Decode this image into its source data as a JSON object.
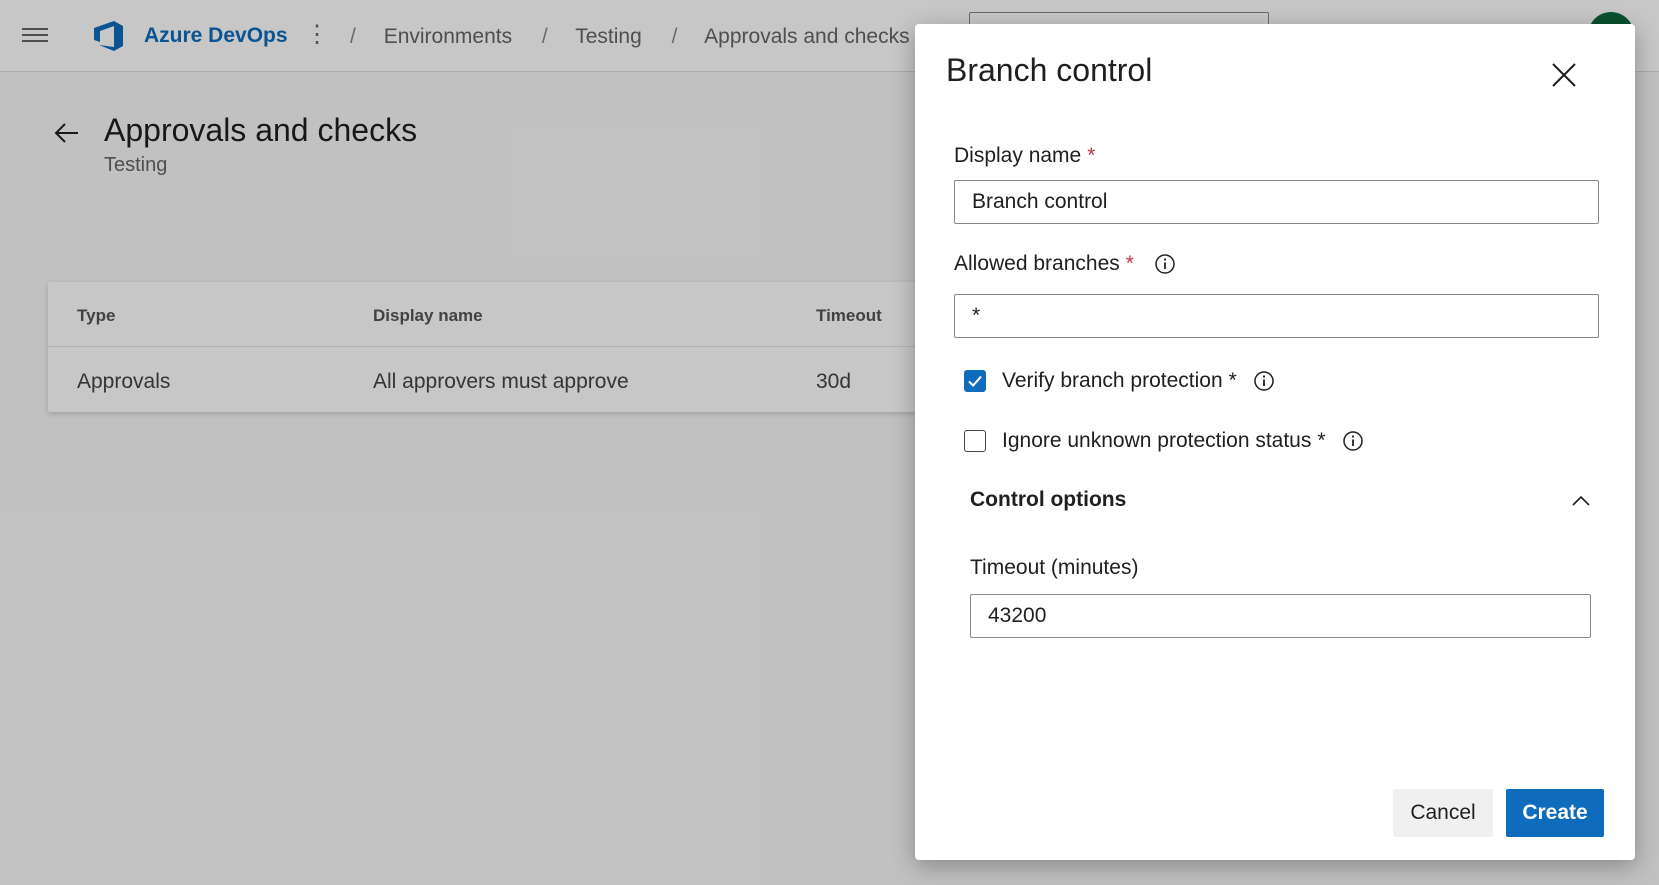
{
  "app": {
    "brand": "Azure DevOps"
  },
  "breadcrumb": [
    "Environments",
    "Testing",
    "Approvals and checks"
  ],
  "page": {
    "title": "Approvals and checks",
    "subtitle": "Testing"
  },
  "table": {
    "headers": [
      "Type",
      "Display name",
      "Timeout"
    ],
    "rows": [
      [
        "Approvals",
        "All approvers must approve",
        "30d"
      ]
    ]
  },
  "panel": {
    "title": "Branch control",
    "display_name": {
      "label": "Display name",
      "value": "Branch control",
      "required": "*"
    },
    "allowed_branches": {
      "label": "Allowed branches",
      "value": "*",
      "required": "*"
    },
    "verify_branch_protection": {
      "label": "Verify branch protection",
      "checked": true,
      "required": "*"
    },
    "ignore_unknown_status": {
      "label": "Ignore unknown protection status",
      "checked": false,
      "required": "*"
    },
    "control_options": {
      "label": "Control options",
      "expanded": true
    },
    "timeout": {
      "label": "Timeout (minutes)",
      "value": "43200"
    },
    "buttons": {
      "cancel": "Cancel",
      "create": "Create"
    }
  },
  "colors": {
    "accent": "#0f6cbd",
    "required": "#c4314b"
  },
  "icons": [
    "hamburger-icon",
    "azure-devops-logo",
    "more-vertical-icon",
    "back-arrow-icon",
    "close-icon",
    "info-icon",
    "check-icon",
    "chevron-up-icon"
  ]
}
